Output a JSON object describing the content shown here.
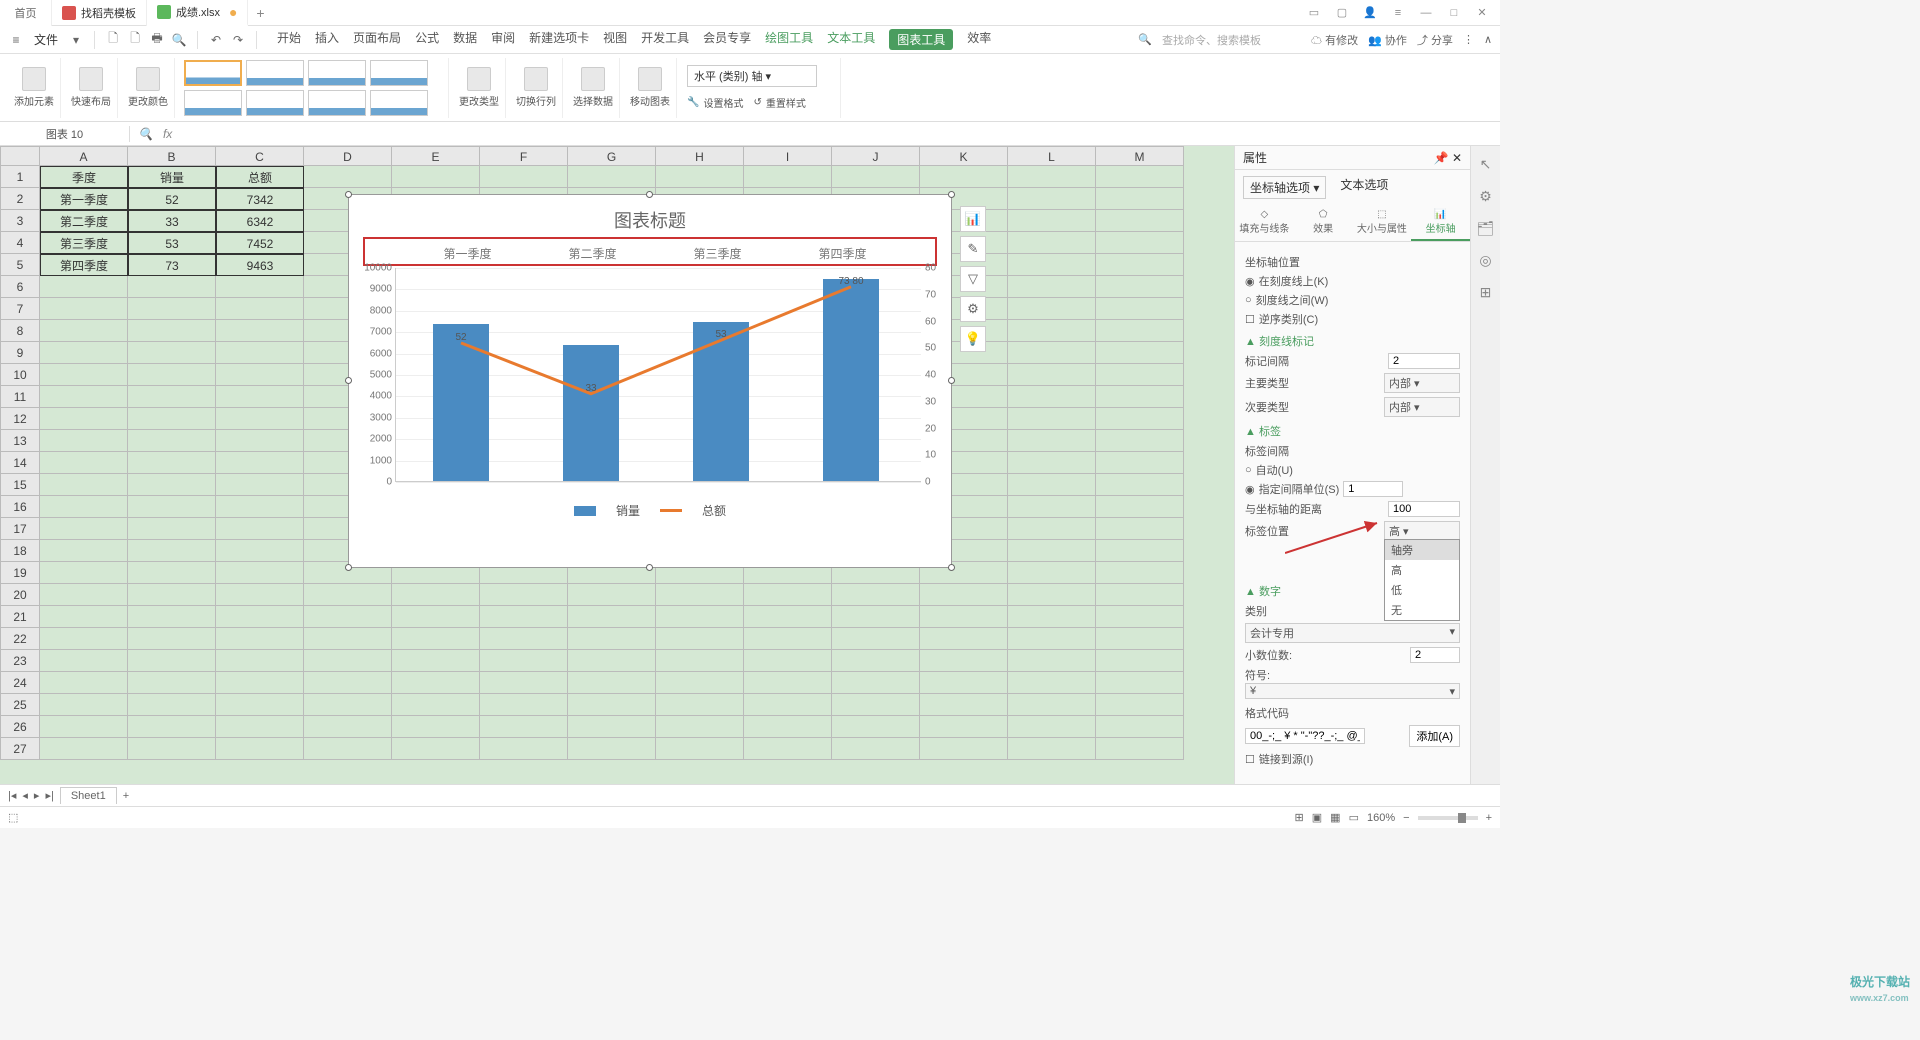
{
  "titlebar": {
    "home": "首页",
    "tab1": "找稻壳模板",
    "tab2": "成绩.xlsx",
    "plus": "+",
    "win_icons": [
      "▭",
      "▢",
      "≡",
      "—",
      "□",
      "✕"
    ],
    "avatar": "👤"
  },
  "menubar": {
    "file": "文件",
    "tabs": [
      "开始",
      "插入",
      "页面布局",
      "公式",
      "数据",
      "审阅",
      "新建选项卡",
      "视图",
      "开发工具",
      "会员专享"
    ],
    "green_tabs": [
      "绘图工具",
      "文本工具"
    ],
    "active_tab": "图表工具",
    "after_active": "效率",
    "search_placeholder": "查找命令、搜索模板",
    "right": {
      "changes": "有修改",
      "coop": "协作",
      "share": "分享"
    }
  },
  "ribbon": {
    "g1": "添加元素",
    "g2": "快速布局",
    "g3": "更改颜色",
    "g4": "更改类型",
    "g5": "切换行列",
    "g6": "选择数据",
    "g7": "移动图表",
    "axis_select": "水平 (类别) 轴",
    "fmt": "设置格式",
    "reset": "重置样式"
  },
  "namebox": "图表 10",
  "fx": "fx",
  "columns": [
    "A",
    "B",
    "C",
    "D",
    "E",
    "F",
    "G",
    "H",
    "I",
    "J",
    "K",
    "L",
    "M"
  ],
  "rows": [
    "1",
    "2",
    "3",
    "4",
    "5",
    "6",
    "7",
    "8",
    "9",
    "10",
    "11",
    "12",
    "13",
    "14",
    "15",
    "16",
    "17",
    "18",
    "19",
    "20",
    "21",
    "22",
    "23",
    "24",
    "25",
    "26",
    "27"
  ],
  "table": {
    "headers": [
      "季度",
      "销量",
      "总额"
    ],
    "data": [
      [
        "第一季度",
        "52",
        "7342"
      ],
      [
        "第二季度",
        "33",
        "6342"
      ],
      [
        "第三季度",
        "53",
        "7452"
      ],
      [
        "第四季度",
        "73",
        "9463"
      ]
    ]
  },
  "chart_data": {
    "type": "bar",
    "title": "图表标题",
    "categories": [
      "第一季度",
      "第二季度",
      "第三季度",
      "第四季度"
    ],
    "series": [
      {
        "name": "销量",
        "type": "line",
        "axis": "y2",
        "values": [
          52,
          33,
          53,
          73
        ],
        "labels": [
          "52",
          "33",
          "53",
          "73 80"
        ]
      },
      {
        "name": "总额",
        "type": "bar",
        "axis": "y1",
        "values": [
          7342,
          6342,
          7452,
          9463
        ]
      }
    ],
    "y1_ticks": [
      "0",
      "1000",
      "2000",
      "3000",
      "4000",
      "5000",
      "6000",
      "7000",
      "8000",
      "9000",
      "10000"
    ],
    "y2_ticks": [
      "0",
      "10",
      "20",
      "30",
      "40",
      "50",
      "60",
      "70",
      "80"
    ],
    "legend": [
      "销量",
      "总额"
    ],
    "ylim": [
      0,
      10000
    ],
    "y2lim": [
      0,
      80
    ]
  },
  "chart_side": [
    "📊",
    "✎",
    "▽",
    "⚙",
    "💡"
  ],
  "panel": {
    "title": "属性",
    "tab1": "坐标轴选项",
    "tab2": "文本选项",
    "opts": [
      "填充与线条",
      "效果",
      "大小与属性",
      "坐标轴"
    ],
    "axis_pos": "坐标轴位置",
    "on_tick": "在刻度线上(K)",
    "between": "刻度线之间(W)",
    "reverse": "逆序类别(C)",
    "tick_marks": "刻度线标记",
    "mark_interval": "标记间隔",
    "mark_interval_v": "2",
    "major": "主要类型",
    "major_v": "内部",
    "minor": "次要类型",
    "minor_v": "内部",
    "labels": "标签",
    "label_interval": "标签间隔",
    "auto": "自动(U)",
    "specify": "指定间隔单位(S)",
    "specify_v": "1",
    "distance": "与坐标轴的距离",
    "distance_v": "100",
    "label_pos": "标签位置",
    "label_pos_v": "高",
    "pos_options": [
      "轴旁",
      "高",
      "低",
      "无"
    ],
    "number": "数字",
    "category": "类别",
    "category_v": "会计专用",
    "decimals": "小数位数:",
    "decimals_v": "2",
    "symbol": "符号:",
    "symbol_v": "¥",
    "fmt_code": "格式代码",
    "fmt_code_v": "00_-;_ ¥ * \"-\"??_-;_ @_",
    "add": "添加(A)",
    "link_source": "链接到源(I)"
  },
  "sheet": {
    "name": "Sheet1",
    "plus": "+"
  },
  "status": {
    "zoom": "160%",
    "zoom_btns": [
      "−",
      "+"
    ]
  },
  "watermark": {
    "brand": "极光下载站",
    "url": "www.xz7.com"
  }
}
